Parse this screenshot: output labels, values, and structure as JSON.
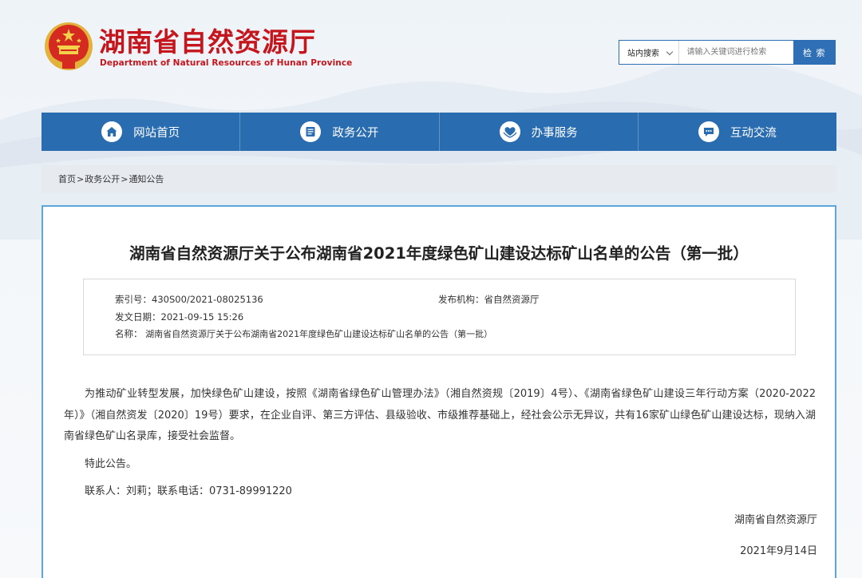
{
  "header": {
    "site_title": "湖南省自然资源厅",
    "site_subtitle": "Department of Natural Resources of Hunan Province"
  },
  "search": {
    "scope_label": "站内搜索",
    "placeholder": "请输入关键词进行检索",
    "button_label": "检 索"
  },
  "nav": {
    "items": [
      {
        "label": "网站首页",
        "icon": "home-icon"
      },
      {
        "label": "政务公开",
        "icon": "document-list-icon"
      },
      {
        "label": "办事服务",
        "icon": "heart-hands-icon"
      },
      {
        "label": "互动交流",
        "icon": "chat-bubble-icon"
      }
    ]
  },
  "breadcrumb": {
    "items": [
      "首页",
      "政务公开",
      "通知公告"
    ],
    "separator": ">"
  },
  "article": {
    "title": "湖南省自然资源厅关于公布湖南省2021年度绿色矿山建设达标矿山名单的公告（第一批）",
    "meta": {
      "index_label": "索引号：",
      "index_value": "430S00/2021-08025136",
      "publisher_label": "发布机构：",
      "publisher_value": "省自然资源厅",
      "date_label": "发文日期：",
      "date_value": "2021-09-15 15:26",
      "name_label": "名称：",
      "name_value": "湖南省自然资源厅关于公布湖南省2021年度绿色矿山建设达标矿山名单的公告（第一批）"
    },
    "paragraph_1": "为推动矿业转型发展，加快绿色矿山建设，按照《湖南省绿色矿山管理办法》（湘自然资规〔2019〕4号）、《湖南省绿色矿山建设三年行动方案（2020-2022年）》（湘自然资发〔2020〕19号）要求，在企业自评、第三方评估、县级验收、市级推荐基础上，经社会公示无异议，共有16家矿山绿色矿山建设达标，现纳入湖南省绿色矿山名录库，接受社会监督。",
    "paragraph_2": "特此公告。",
    "paragraph_3": "联系人：刘莉；联系电话：0731-89991220",
    "signature_org": "湖南省自然资源厅",
    "signature_date": "2021年9月14日"
  },
  "colors": {
    "brand_red": "#c4161c",
    "nav_blue": "#2a6cb0",
    "content_border": "#5ea6d9"
  }
}
